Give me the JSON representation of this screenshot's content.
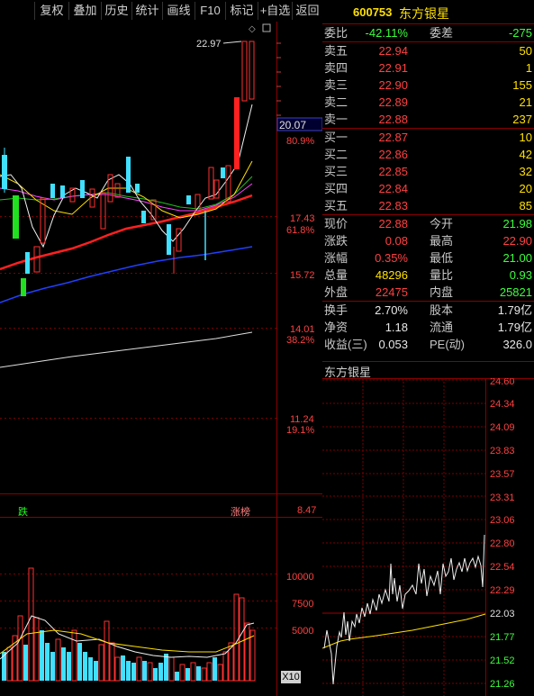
{
  "toolbar": {
    "buttons": [
      "复权",
      "叠加",
      "历史",
      "统计",
      "画线",
      "F10",
      "标记",
      "+自选",
      "返回"
    ]
  },
  "kline": {
    "price_axis": [
      {
        "value": "20.07",
        "boxed": true
      },
      {
        "value": "80.9%"
      },
      {
        "value": "17.43"
      },
      {
        "value": "61.8%"
      },
      {
        "value": "15.72"
      },
      {
        "value": "14.01"
      },
      {
        "value": "38.2%"
      },
      {
        "value": "11.24"
      },
      {
        "value": "19.1%"
      },
      {
        "value": "8.47"
      }
    ],
    "high_marker": "22.97",
    "volume_axis": [
      "10000",
      "7500",
      "5000"
    ],
    "volume_scale": "X10",
    "tags": {
      "die": "跌",
      "liangbang": "涨榜"
    }
  },
  "stock": {
    "code": "600753",
    "name": "东方银星"
  },
  "quote": {
    "weibi": {
      "label": "委比",
      "value": "-42.11%",
      "label2": "委差",
      "value2": "-275"
    },
    "sell": [
      {
        "label": "卖五",
        "price": "22.94",
        "vol": "50"
      },
      {
        "label": "卖四",
        "price": "22.91",
        "vol": "1"
      },
      {
        "label": "卖三",
        "price": "22.90",
        "vol": "155"
      },
      {
        "label": "卖二",
        "price": "22.89",
        "vol": "21"
      },
      {
        "label": "卖一",
        "price": "22.88",
        "vol": "237"
      }
    ],
    "buy": [
      {
        "label": "买一",
        "price": "22.87",
        "vol": "10"
      },
      {
        "label": "买二",
        "price": "22.86",
        "vol": "42"
      },
      {
        "label": "买三",
        "price": "22.85",
        "vol": "32"
      },
      {
        "label": "买四",
        "price": "22.84",
        "vol": "20"
      },
      {
        "label": "买五",
        "price": "22.83",
        "vol": "85"
      }
    ],
    "stats": [
      {
        "l1": "现价",
        "v1": "22.88",
        "c1": "red",
        "l2": "今开",
        "v2": "21.98",
        "c2": "green"
      },
      {
        "l1": "涨跌",
        "v1": "0.08",
        "c1": "red",
        "l2": "最高",
        "v2": "22.90",
        "c2": "red"
      },
      {
        "l1": "涨幅",
        "v1": "0.35%",
        "c1": "red",
        "l2": "最低",
        "v2": "21.00",
        "c2": "green"
      },
      {
        "l1": "总量",
        "v1": "48296",
        "c1": "yellow",
        "l2": "量比",
        "v2": "0.93",
        "c2": "green"
      },
      {
        "l1": "外盘",
        "v1": "22475",
        "c1": "red",
        "l2": "内盘",
        "v2": "25821",
        "c2": "green"
      }
    ],
    "extra": [
      {
        "l1": "换手",
        "v1": "2.70%",
        "l2": "股本",
        "v2": "1.79亿"
      },
      {
        "l1": "净资",
        "v1": "1.18",
        "l2": "流通",
        "v2": "1.79亿"
      },
      {
        "l1": "收益(三)",
        "v1": "0.053",
        "l2": "PE(动)",
        "v2": "326.0"
      }
    ]
  },
  "minute": {
    "title": "东方银星",
    "axis": [
      "24.60",
      "24.34",
      "24.09",
      "23.83",
      "23.57",
      "23.31",
      "23.06",
      "22.80",
      "22.54",
      "22.29",
      "22.03",
      "21.77",
      "21.52",
      "21.26"
    ],
    "colors": {
      "up": "#ff4040",
      "flat": "#e8e8e8",
      "down": "#3cff3c"
    }
  }
}
